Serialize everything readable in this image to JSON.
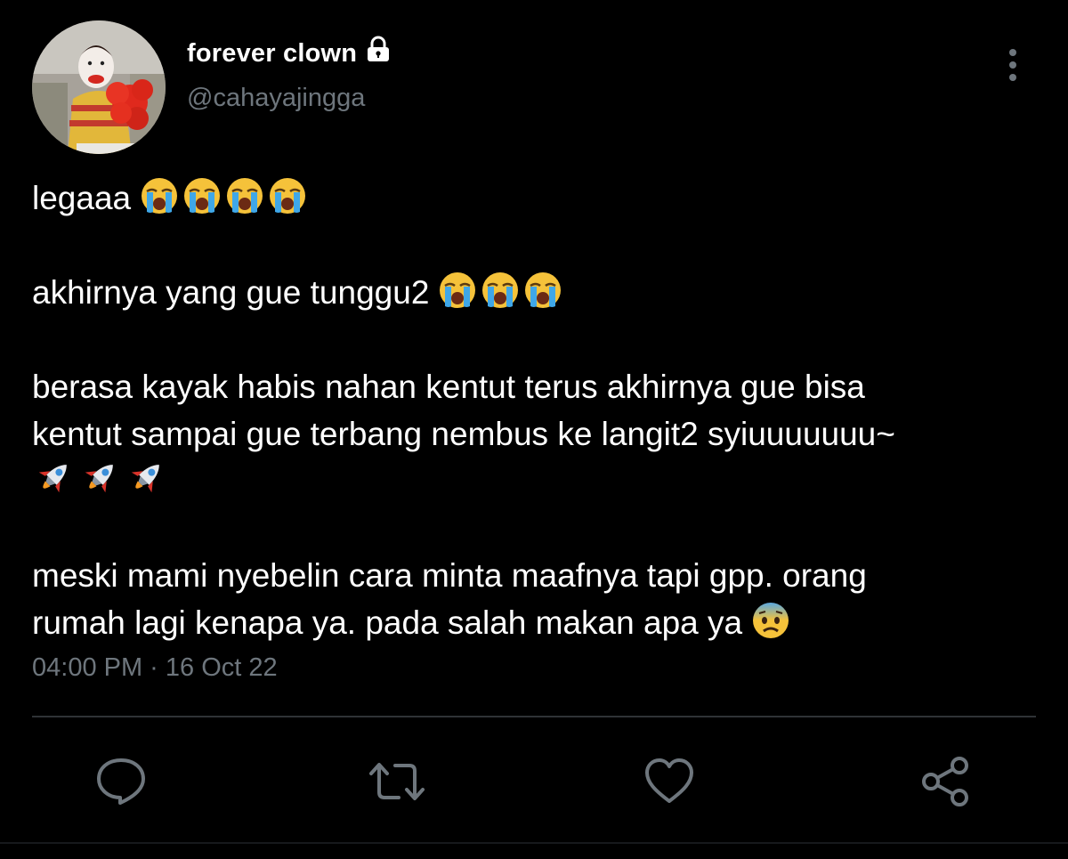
{
  "user": {
    "display_name": "forever clown",
    "handle": "@cahayajingga",
    "protected_icon": "lock-icon",
    "avatar_icon": "clown-avatar"
  },
  "tweet": {
    "lines": [
      "legaaa",
      "akhirnya yang gue tunggu2",
      "berasa kayak habis nahan kentut terus akhirnya gue bisa",
      "kentut sampai gue terbang nembus ke langit2 syiuuuuuuu~",
      "meski mami nyebelin cara minta maafnya tapi gpp. orang",
      "rumah lagi kenapa ya. pada salah makan apa ya"
    ],
    "emojis": {
      "line1": "loudly-crying-face x4",
      "line2": "loudly-crying-face x3",
      "line3": "rocket x3",
      "line4": "anxious-face-with-sweat x1"
    }
  },
  "meta": {
    "timestamp": "04:00 PM · 16 Oct 22"
  },
  "actions": {
    "reply_icon": "reply-icon",
    "retweet_icon": "retweet-icon",
    "like_icon": "heart-icon",
    "share_icon": "share-icon",
    "more_icon": "more-vertical-icon"
  },
  "colors": {
    "background": "#000000",
    "text_primary": "#ffffff",
    "text_secondary": "#6e767d",
    "divider": "#2f3336"
  }
}
